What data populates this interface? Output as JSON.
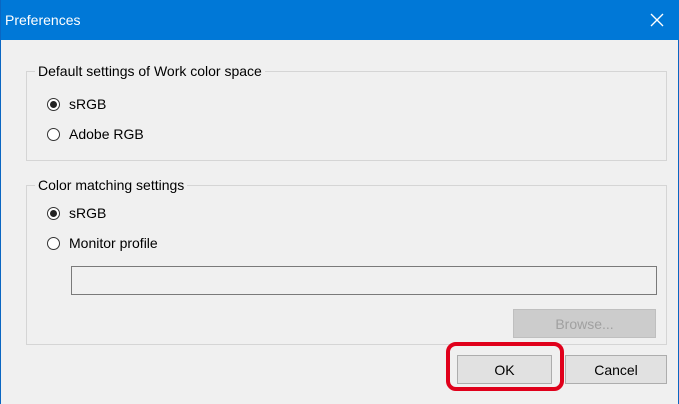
{
  "window": {
    "title": "Preferences",
    "close_icon": "close-icon"
  },
  "colors": {
    "titlebar": "#0078d7",
    "dialog_bg": "#f0f0f0",
    "highlight": "#e0001b"
  },
  "work_color_space": {
    "legend": "Default settings of Work color space",
    "options": [
      {
        "label": "sRGB",
        "selected": true
      },
      {
        "label": "Adobe RGB",
        "selected": false
      }
    ]
  },
  "color_matching": {
    "legend": "Color matching settings",
    "options": [
      {
        "label": "sRGB",
        "selected": true
      },
      {
        "label": "Monitor profile",
        "selected": false
      }
    ],
    "profile_path": "",
    "browse_label": "Browse..."
  },
  "footer": {
    "ok_label": "OK",
    "cancel_label": "Cancel"
  }
}
